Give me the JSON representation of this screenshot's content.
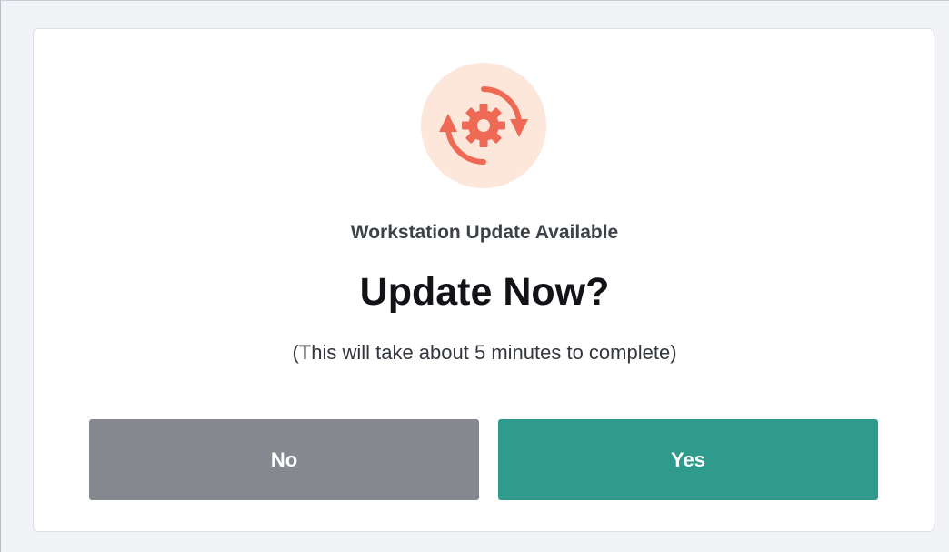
{
  "dialog": {
    "icon": "sync-gear-icon",
    "subtitle": "Workstation Update Available",
    "title": "Update Now?",
    "description": "(This will take about 5 minutes to complete)",
    "no_label": "No",
    "yes_label": "Yes"
  },
  "colors": {
    "icon_background": "#fde6da",
    "icon_accent": "#ee6a55",
    "no_button": "#85888f",
    "yes_button": "#2e9b8d"
  }
}
